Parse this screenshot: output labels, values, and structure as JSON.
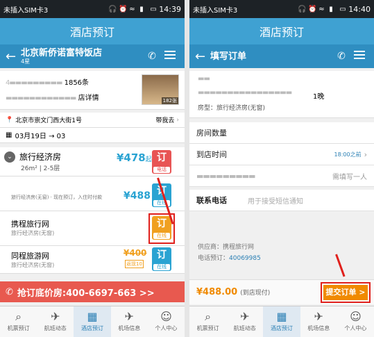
{
  "status": {
    "left": {
      "carrier": "未插入SIM卡3",
      "time": "14:39"
    },
    "right": {
      "carrier": "未插入SIM卡3",
      "time": "14:40"
    }
  },
  "app_title": "酒店预订",
  "hotel_screen": {
    "hotel_name": "北京新侨诺富特饭店",
    "stars": "4星",
    "reviews_text": "1856条",
    "detail_text": "店详情",
    "photo_count": "182张",
    "address": "北京市崇文门西大街1号",
    "nav_label": "带我去",
    "dates": "03月19日 → 03",
    "room_type": "旅行经济房",
    "room_price": "¥478",
    "room_price_suffix": "起",
    "room_size": "26m²",
    "room_floor": "2-5层",
    "book_label": "订",
    "phone_sub": "电话",
    "online_sub": "在线",
    "offer1_desc": "旅行经济房(无窗) · 现在预订，入住时付款",
    "offer1_price": "¥488",
    "supplier1_name": "携程旅行网",
    "supplier1_desc": "旅行经济房(无窗)",
    "supplier2_name": "同程旅游网",
    "supplier2_desc": "旅行经济房(无窗)",
    "supplier2_price": "¥400",
    "cashback": "返现10",
    "promo_text": "抢订底价房:400-6697-663 >>"
  },
  "order_screen": {
    "title": "填写订单",
    "nights": "1晚",
    "room_type": "房型：旅行经济房(无窗)",
    "room_count_label": "房间数量",
    "arrival_label": "到店时间",
    "arrival_value": "18:00之前",
    "guest_hint": "需填写一人",
    "phone_label": "联系电话",
    "phone_placeholder": "用于接受短信通知",
    "supplier": "供应商：携程旅行网",
    "booking_phone_label": "电话预订：",
    "booking_phone": "40069985",
    "total_price": "¥488.00",
    "pay_note": "(到店现付)",
    "submit_label": "提交订单 >"
  },
  "tabs": [
    "机票预订",
    "航班动态",
    "酒店预订",
    "机场信息",
    "个人中心"
  ]
}
